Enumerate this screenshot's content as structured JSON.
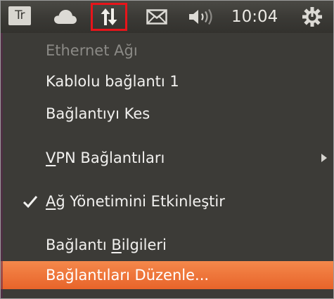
{
  "panel": {
    "keyboard_layout": "Tr",
    "indicators": [
      {
        "icon": "cloud-icon"
      },
      {
        "icon": "network-updown-icon",
        "highlighted": true,
        "highlight_color": "#e8141a"
      },
      {
        "icon": "mail-envelope-icon"
      },
      {
        "icon": "volume-icon"
      },
      {
        "icon": "power-gear-icon"
      }
    ],
    "clock": "10:04"
  },
  "menu": {
    "items": [
      {
        "label": "Ethernet Ağı",
        "enabled": false
      },
      {
        "label": "Kablolu bağlantı 1",
        "enabled": true
      },
      {
        "label": "Bağlantıyı Kes",
        "enabled": true
      },
      {
        "label_pre": "",
        "label_mnemonic": "V",
        "label_post": "PN Bağlantıları",
        "enabled": true,
        "submenu": true
      },
      {
        "label_pre": "",
        "label_mnemonic": "A",
        "label_post": "ğ Yönetimini Etkinleştir",
        "enabled": true,
        "checked": true
      },
      {
        "label_pre": "Bağlantı ",
        "label_mnemonic": "B",
        "label_post": "ilgileri",
        "enabled": true
      },
      {
        "label": "Bağlantıları Düzenle...",
        "enabled": true,
        "selected": true
      }
    ]
  },
  "colors": {
    "panel_bg": "#3a3935",
    "menu_bg": "#3c3b37",
    "menu_text": "#f2f1ef",
    "disabled_text": "#8b8a86",
    "selection_orange": "#e8642a"
  }
}
